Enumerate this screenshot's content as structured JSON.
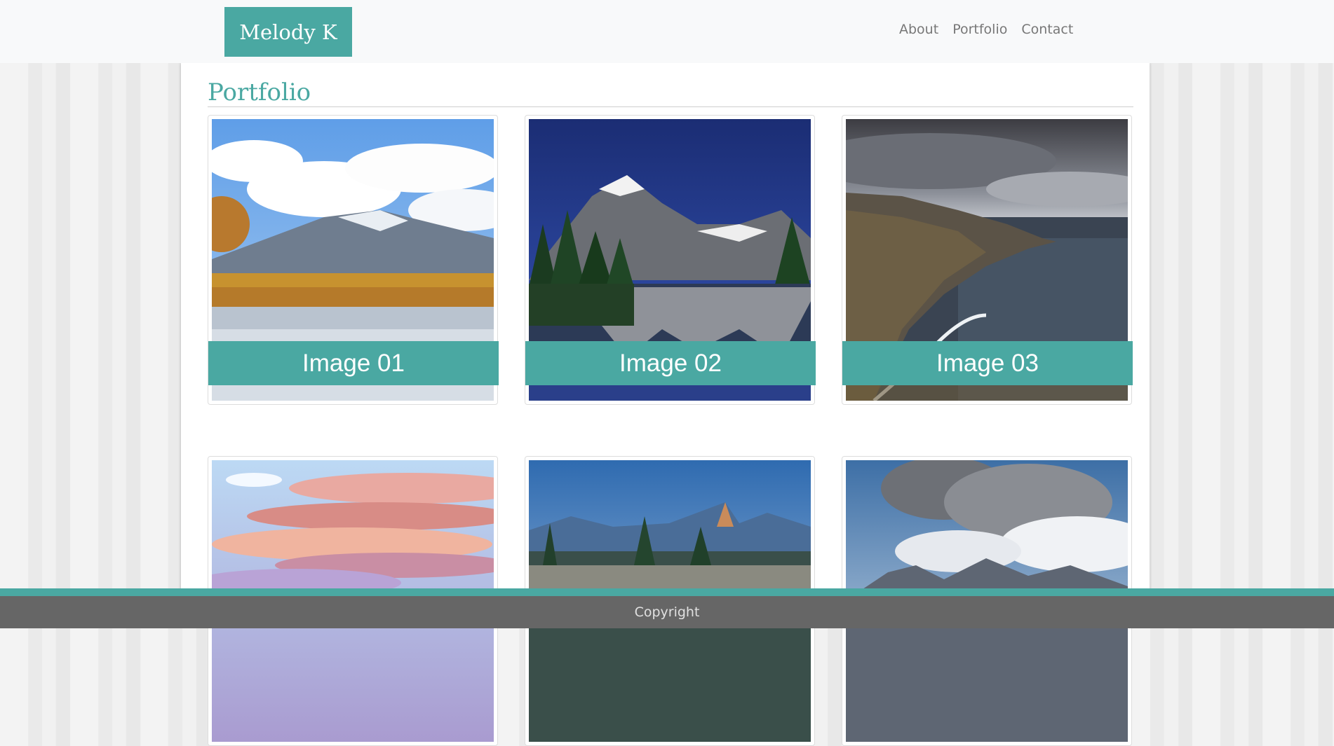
{
  "brand": {
    "name": "Melody K"
  },
  "nav": {
    "items": [
      {
        "label": "About"
      },
      {
        "label": "Portfolio"
      },
      {
        "label": "Contact"
      }
    ]
  },
  "page": {
    "title": "Portfolio"
  },
  "gallery": {
    "items": [
      {
        "caption": "Image 01",
        "scene": "autumn-mountain-lake"
      },
      {
        "caption": "Image 02",
        "scene": "alpine-lake-reflection"
      },
      {
        "caption": "Image 03",
        "scene": "sea-cliffs"
      },
      {
        "caption": "",
        "scene": "sunset-clouds"
      },
      {
        "caption": "",
        "scene": "mountain-forest"
      },
      {
        "caption": "",
        "scene": "cloudy-peaks"
      }
    ]
  },
  "footer": {
    "text": "Copyright"
  },
  "colors": {
    "accent": "#4aa8a2",
    "navbar_bg": "#f8f9fa",
    "footer_bg": "#666666"
  }
}
